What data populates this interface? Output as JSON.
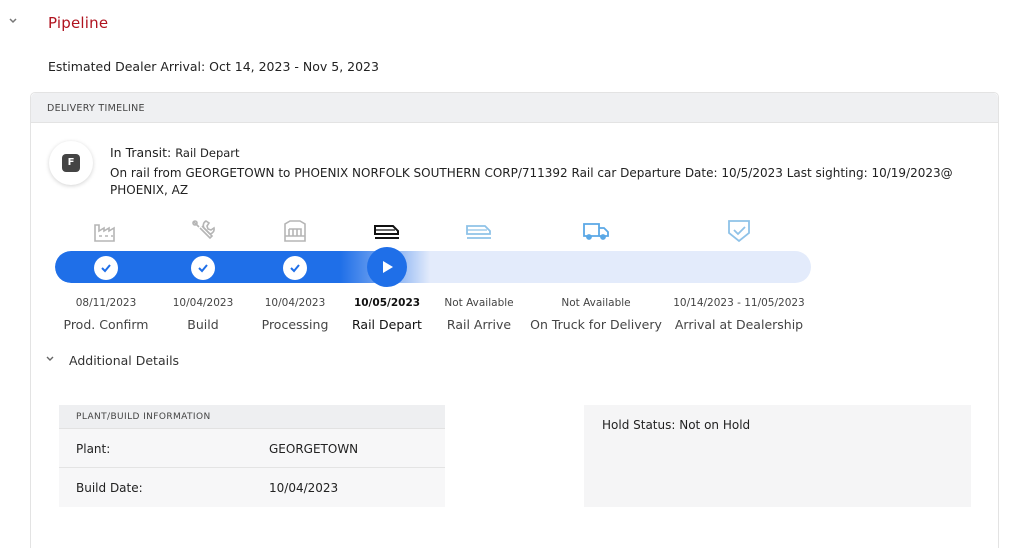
{
  "section": {
    "title": "Pipeline"
  },
  "estimated_arrival": "Estimated Dealer Arrival: Oct 14, 2023 - Nov 5, 2023",
  "timeline": {
    "header": "DELIVERY TIMELINE",
    "badge_letter": "F",
    "status_prefix": "In Transit:",
    "status_value": "Rail Depart",
    "status_detail": "On rail from GEORGETOWN to PHOENIX NORFOLK SOUTHERN CORP/711392 Rail car Departure Date: 10/5/2023 Last sighting: 10/19/2023@ PHOENIX, AZ",
    "progress_completed_steps": 3,
    "current_step": 4,
    "steps": [
      {
        "icon": "factory-icon",
        "date": "08/11/2023",
        "label": "Prod. Confirm",
        "state": "completed"
      },
      {
        "icon": "wrench-icon",
        "date": "10/04/2023",
        "label": "Build",
        "state": "completed"
      },
      {
        "icon": "processing-icon",
        "date": "10/04/2023",
        "label": "Processing",
        "state": "completed"
      },
      {
        "icon": "rail-icon",
        "date": "10/05/2023",
        "label": "Rail Depart",
        "state": "current"
      },
      {
        "icon": "rail-icon",
        "date": "Not Available",
        "label": "Rail Arrive",
        "state": "upcoming"
      },
      {
        "icon": "truck-icon",
        "date": "Not Available",
        "label": "On Truck for Delivery",
        "state": "upcoming"
      },
      {
        "icon": "shield-check-icon",
        "date": "10/14/2023 - 11/05/2023",
        "label": "Arrival at Dealership",
        "state": "upcoming"
      }
    ]
  },
  "additional_details": {
    "label": "Additional Details",
    "plant_info": {
      "header": "PLANT/BUILD INFORMATION",
      "rows": [
        {
          "key": "Plant:",
          "value": "GEORGETOWN"
        },
        {
          "key": "Build Date:",
          "value": "10/04/2023"
        }
      ]
    },
    "hold_status": "Hold Status: Not on Hold"
  },
  "colors": {
    "brand_red": "#b0131f",
    "progress_blue": "#1f6fe8",
    "track_light": "#e3ebfb",
    "upcoming_icon": "#8ec2e8",
    "completed_icon": "#b5b5b5"
  }
}
